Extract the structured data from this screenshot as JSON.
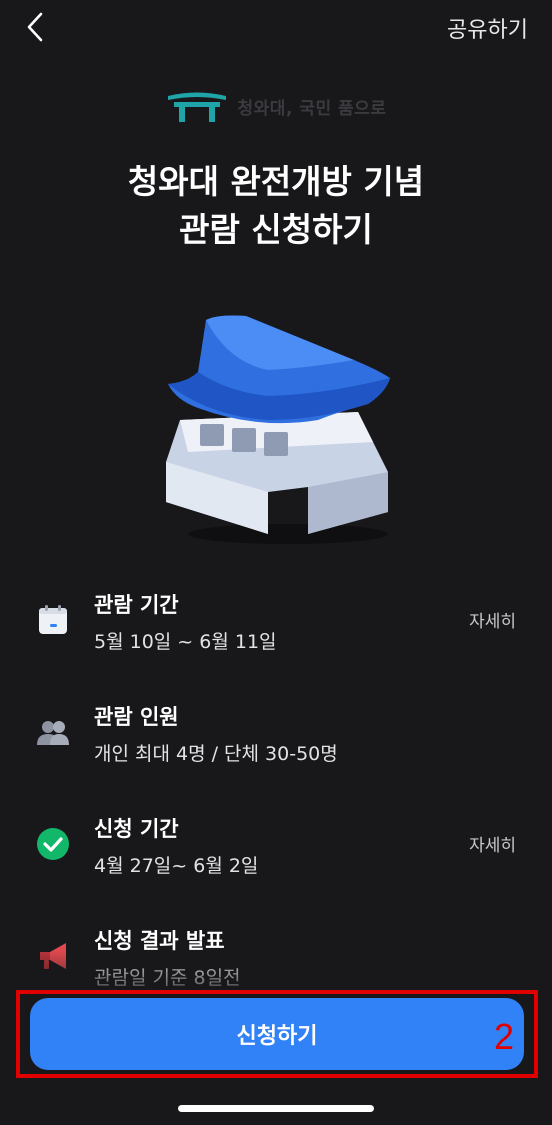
{
  "header": {
    "back_icon": "chevron-left-icon",
    "share_label": "공유하기"
  },
  "brand": {
    "logo_icon": "gate-roof-icon",
    "text": "청와대, 국민 품으로",
    "logo_color": "#1fa5a8"
  },
  "title": {
    "line1": "청와대 완전개방 기념",
    "line2": "관람 신청하기"
  },
  "hero_icon": "blue-house-icon",
  "info": [
    {
      "icon": "calendar-icon",
      "title": "관람 기간",
      "sub": "5월 10일 ~ 6월 11일",
      "detail": "자세히"
    },
    {
      "icon": "people-icon",
      "title": "관람 인원",
      "sub": "개인 최대 4명 / 단체 30-50명",
      "detail": ""
    },
    {
      "icon": "check-circle-icon",
      "title": "신청 기간",
      "sub": "4월 27일~ 6월 2일",
      "detail": "자세히"
    },
    {
      "icon": "megaphone-icon",
      "title": "신청 결과 발표",
      "sub": "관람일 기준 8일전",
      "detail": ""
    }
  ],
  "apply_button": {
    "label": "신청하기",
    "color": "#3182f6"
  },
  "annotation": {
    "label": "2",
    "color": "#e00000"
  }
}
